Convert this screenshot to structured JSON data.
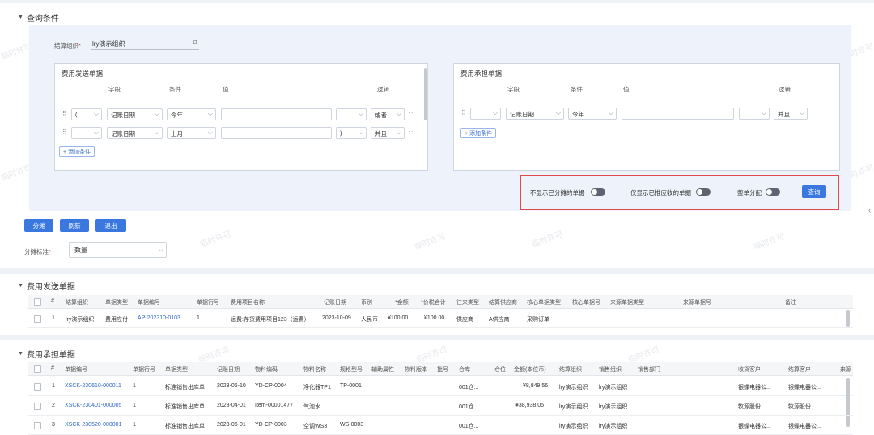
{
  "query": {
    "section_title": "查询条件",
    "org_label": "结算组织",
    "org_value": "lry演示组织",
    "send_panel": {
      "title": "费用发送单据",
      "col_field": "字段",
      "col_cond": "条件",
      "col_value": "值",
      "col_logic": "逻辑",
      "rows": [
        {
          "paren": "(",
          "field": "记账日期",
          "cond": "今年",
          "close": "",
          "logic": "或者"
        },
        {
          "paren": "",
          "field": "记账日期",
          "cond": "上月",
          "close": ")",
          "logic": "并且"
        }
      ],
      "add_label": "+ 添加条件"
    },
    "bear_panel": {
      "title": "费用承担单据",
      "col_field": "字段",
      "col_cond": "条件",
      "col_value": "值",
      "col_logic": "逻辑",
      "rows": [
        {
          "paren": "",
          "field": "记账日期",
          "cond": "今年",
          "close": "",
          "logic": "并且"
        }
      ],
      "add_label": "+ 添加条件"
    },
    "toggle1_label": "不显示已分摊的单据",
    "toggle2_label": "仅显示已推应收的单据",
    "toggle3_label": "整单分配",
    "query_button": "查询"
  },
  "actions": {
    "allocate": "分摊",
    "refresh": "刷新",
    "exit": "退出",
    "standard_label": "分摊标准",
    "standard_value": "数量"
  },
  "send_table": {
    "title": "费用发送单据",
    "headers": [
      "#",
      "结算组织",
      "单据类型",
      "单据编号",
      "单据行号",
      "费用项目名称",
      "记账日期",
      "币别",
      "*金额",
      "*价税合计",
      "往来类型",
      "结算供应商",
      "核心单据类型",
      "核心单据号",
      "来源单据类型",
      "来源单据号",
      "备注"
    ],
    "rows": [
      [
        "1",
        "lry演示组织",
        "费用应付",
        "AP-202310-0103...",
        "1",
        "运费:存货费用项目123（运费）",
        "2023-10-09",
        "人民币",
        "¥100.00",
        "¥100.00",
        "供应商",
        "A供应商",
        "采购订单",
        "",
        "",
        "",
        ""
      ]
    ]
  },
  "bear_table": {
    "title": "费用承担单据",
    "headers": [
      "#",
      "单据编号",
      "单据行号",
      "单据类型",
      "记账日期",
      "物料编码",
      "物料名称",
      "规格型号",
      "辅助属性",
      "物料版本",
      "批号",
      "仓库",
      "仓位",
      "金额(本位币)",
      "结算组织",
      "销售组织",
      "销售部门",
      "收货客户",
      "结算客户",
      "来源"
    ],
    "rows": [
      [
        "1",
        "XSCK-230610-000011",
        "1",
        "标准销售出库单",
        "2023-06-10",
        "YD-CP-0004",
        "净化器TP1",
        "TP-0001",
        "",
        "",
        "",
        "001仓...",
        "",
        "¥8,849.56",
        "lry演示组织",
        "lry演示组织",
        "",
        "银蝶电器公...",
        "银蝶电器公...",
        ""
      ],
      [
        "2",
        "XSCK-230401-000005",
        "1",
        "标准销售出库单",
        "2023-04-01",
        "Item-00001477",
        "气泡水",
        "",
        "",
        "",
        "",
        "001仓...",
        "",
        "¥38,938.05",
        "lry演示组织",
        "lry演示组织",
        "",
        "牧源股份",
        "牧源股份",
        ""
      ],
      [
        "3",
        "XSCK-230520-000001",
        "1",
        "标准销售出库单",
        "2023-06-01",
        "YD-CP-0003",
        "空调WS3",
        "WS-0003",
        "",
        "",
        "",
        "001仓...",
        "",
        "",
        "lry演示组织",
        "lry演示组织",
        "",
        "银蝶电器公...",
        "银蝶电器公...",
        ""
      ]
    ]
  },
  "watermark": "临时许可"
}
